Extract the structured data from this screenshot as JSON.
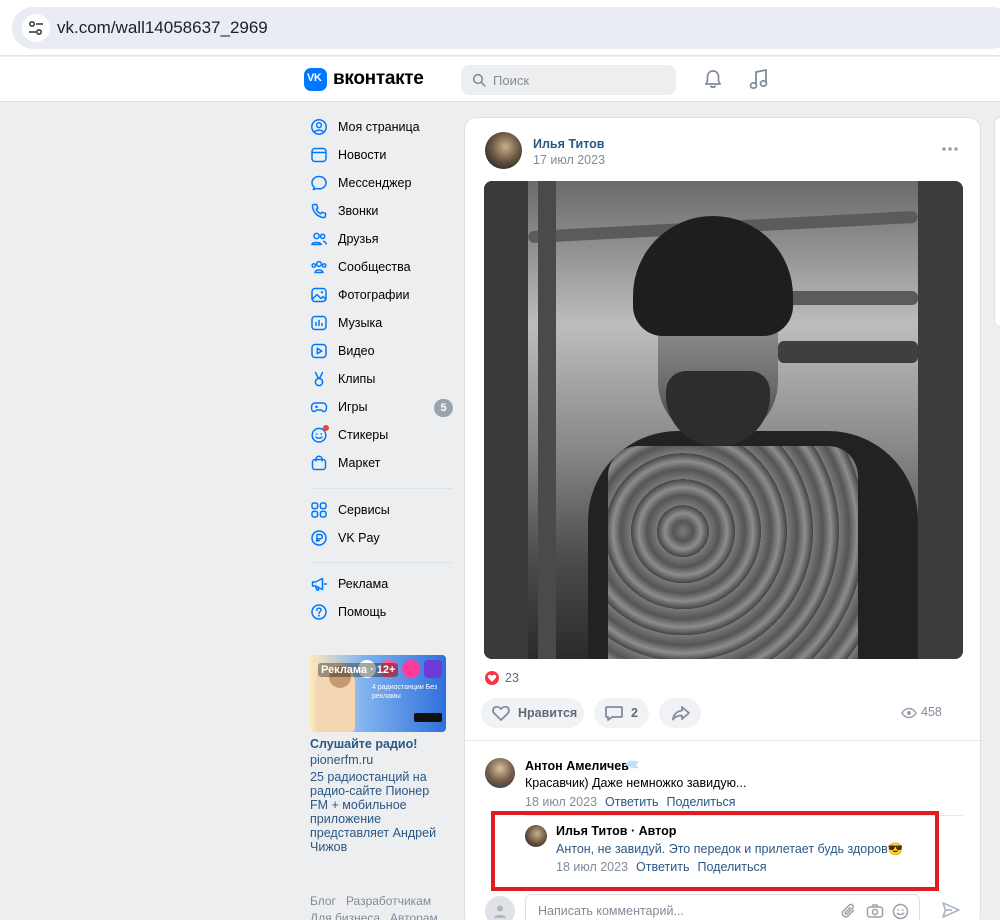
{
  "browser": {
    "url": "vk.com/wall14058637_2969"
  },
  "header": {
    "logo_mark": "VK",
    "wordmark": "вконтакте",
    "search_placeholder": "Поиск",
    "brand_color": "#0077ff"
  },
  "sidebar": {
    "items": [
      {
        "label": "Моя страница",
        "icon": "user-circle-icon"
      },
      {
        "label": "Новости",
        "icon": "news-icon"
      },
      {
        "label": "Мессенджер",
        "icon": "message-icon"
      },
      {
        "label": "Звонки",
        "icon": "phone-icon"
      },
      {
        "label": "Друзья",
        "icon": "friends-icon"
      },
      {
        "label": "Сообщества",
        "icon": "communities-icon"
      },
      {
        "label": "Фотографии",
        "icon": "photo-icon"
      },
      {
        "label": "Музыка",
        "icon": "music-icon"
      },
      {
        "label": "Видео",
        "icon": "video-icon"
      },
      {
        "label": "Клипы",
        "icon": "clips-icon"
      },
      {
        "label": "Игры",
        "icon": "gamepad-icon",
        "badge": "5"
      },
      {
        "label": "Стикеры",
        "icon": "sticker-icon"
      },
      {
        "label": "Маркет",
        "icon": "market-icon"
      },
      {
        "label": "Сервисы",
        "icon": "services-icon"
      },
      {
        "label": "VK Pay",
        "icon": "vkpay-icon"
      },
      {
        "label": "Реклама",
        "icon": "megaphone-icon"
      },
      {
        "label": "Помощь",
        "icon": "help-icon"
      }
    ],
    "ad": {
      "badge": "Реклама · 12+",
      "banner_text": "4 радиостанции Без рекламы",
      "title": "Слушайте радио!",
      "domain": "pionerfm.ru",
      "description": "25 радиостанций на радио-сайте Пионер FM + мобильное приложение представляет Андрей Чижов"
    },
    "footer": [
      "Блог",
      "Разработчикам",
      "Для бизнеса",
      "Авторам"
    ]
  },
  "post": {
    "author": "Илья Титов",
    "date": "17 июл 2023",
    "likes": "23",
    "like_label": "Нравится",
    "comments_count": "2",
    "views": "458"
  },
  "comments": [
    {
      "author": "Антон Амеличев",
      "text": "Красавчик) Даже немножко завидую...",
      "date": "18 июл 2023",
      "reply": "Ответить",
      "share": "Поделиться"
    },
    {
      "author": "Илья Титов · Автор",
      "text": "Антон, не завидуй. Это передок и прилетает будь здоров😎",
      "date": "18 июл 2023",
      "reply": "Ответить",
      "share": "Поделиться"
    }
  ],
  "comment_input": {
    "placeholder": "Написать комментарий..."
  },
  "colors": {
    "link": "#2a5885",
    "highlight": "#e01b22",
    "like": "#ff3347"
  }
}
